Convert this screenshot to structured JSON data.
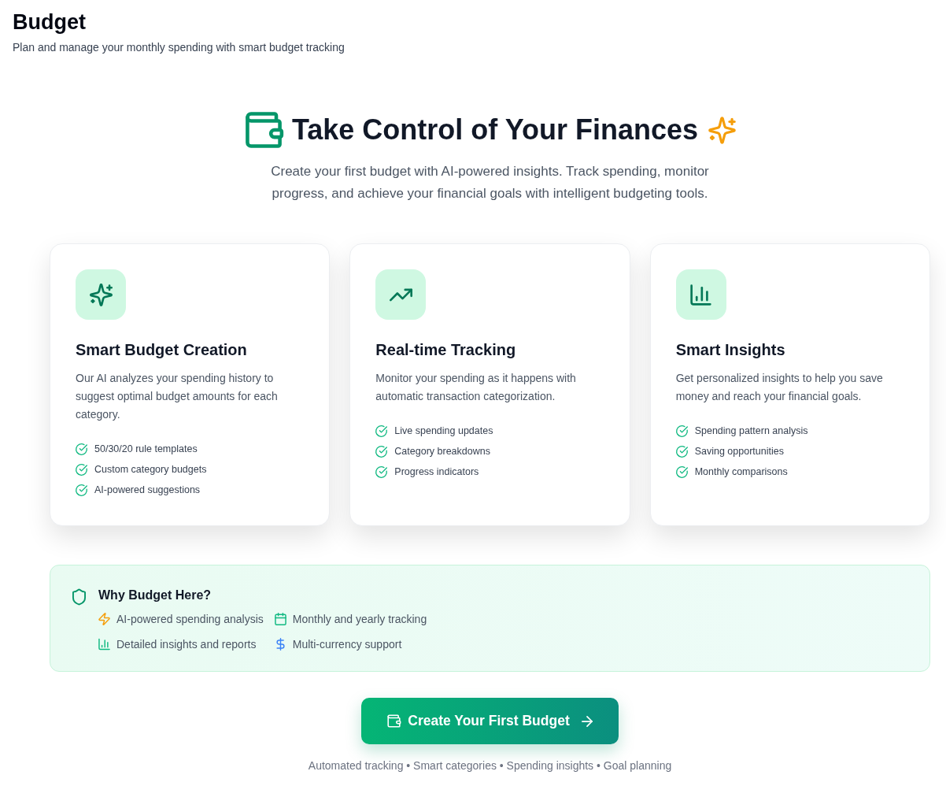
{
  "header": {
    "title": "Budget",
    "subtitle": "Plan and manage your monthly spending with smart budget tracking"
  },
  "hero": {
    "title": "Take Control of Your Finances",
    "description": "Create your first budget with AI-powered insights. Track spending, monitor progress, and achieve your financial goals with intelligent budgeting tools."
  },
  "cards": [
    {
      "kind": "creation",
      "title": "Smart Budget Creation",
      "description": "Our AI analyzes your spending history to suggest optimal budget amounts for each category.",
      "features": [
        "50/30/20 rule templates",
        "Custom category budgets",
        "AI-powered suggestions"
      ]
    },
    {
      "kind": "tracking",
      "title": "Real-time Tracking",
      "description": "Monitor your spending as it happens with automatic transaction categorization.",
      "features": [
        "Live spending updates",
        "Category breakdowns",
        "Progress indicators"
      ]
    },
    {
      "kind": "insights",
      "title": "Smart Insights",
      "description": "Get personalized insights to help you save money and reach your financial goals.",
      "features": [
        "Spending pattern analysis",
        "Saving opportunities",
        "Monthly comparisons"
      ]
    }
  ],
  "why": {
    "title": "Why Budget Here?",
    "items": [
      {
        "kind": "analysis",
        "text": "AI-powered spending analysis"
      },
      {
        "kind": "period",
        "text": "Monthly and yearly tracking"
      },
      {
        "kind": "reports",
        "text": "Detailed insights and reports"
      },
      {
        "kind": "currency",
        "text": "Multi-currency support"
      }
    ]
  },
  "cta": {
    "label": "Create Your First Budget"
  },
  "footer_note": "Automated tracking • Smart categories • Spending insights • Goal planning"
}
